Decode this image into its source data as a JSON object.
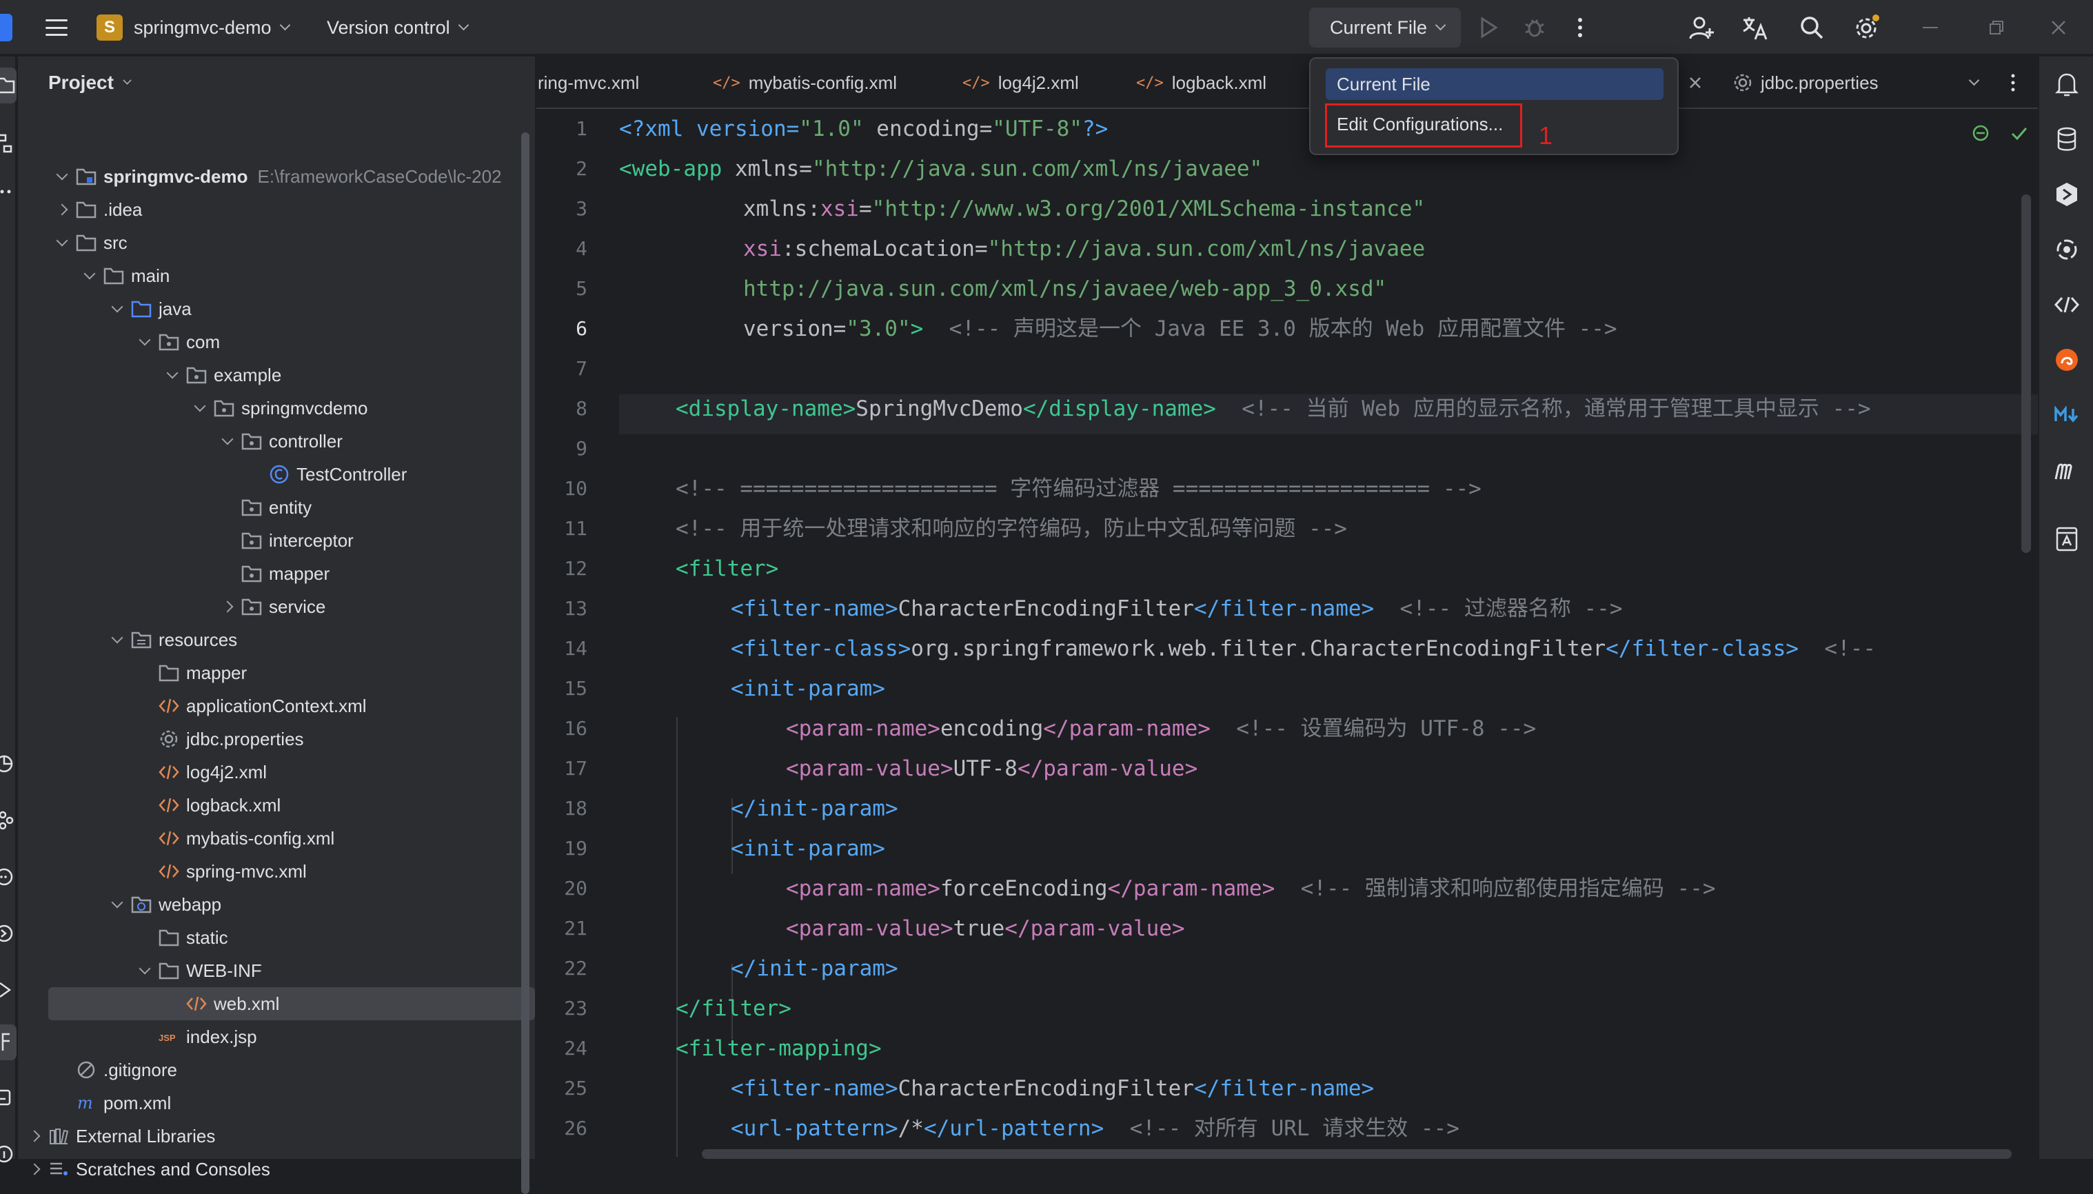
{
  "top_bar": {
    "project_badge": "S",
    "project_name": "springmvc-demo",
    "version_control": "Version control",
    "run_config": "Current File"
  },
  "run_menu": {
    "items": [
      "Current File",
      "Edit Configurations..."
    ],
    "annotation": "1"
  },
  "project_panel": {
    "title": "Project",
    "root_name": "springmvc-demo",
    "root_path": "E:\\frameworkCaseCode\\lc-202",
    "items": [
      ".idea",
      "src",
      "main",
      "java",
      "com",
      "example",
      "springmvcdemo",
      "controller",
      "TestController",
      "entity",
      "interceptor",
      "mapper",
      "service",
      "resources",
      "mapper",
      "applicationContext.xml",
      "jdbc.properties",
      "log4j2.xml",
      "logback.xml",
      "mybatis-config.xml",
      "spring-mvc.xml",
      "webapp",
      "static",
      "WEB-INF",
      "web.xml",
      "index.jsp",
      ".gitignore",
      "pom.xml",
      "External Libraries",
      "Scratches and Consoles"
    ]
  },
  "editor_tabs": [
    "ring-mvc.xml",
    "mybatis-config.xml",
    "log4j2.xml",
    "logback.xml",
    "jdbc.properties"
  ],
  "editor": {
    "current_line": 6,
    "line_numbers": [
      "1",
      "2",
      "3",
      "4",
      "5",
      "6",
      "7",
      "8",
      "9",
      "10",
      "11",
      "12",
      "13",
      "14",
      "15",
      "16",
      "17",
      "18",
      "19",
      "20",
      "21",
      "22",
      "23",
      "24",
      "25",
      "26"
    ],
    "code": {
      "l1": [
        "<?xml version=",
        "\"1.0\"",
        " encoding=",
        "\"UTF-8\"",
        "?>"
      ],
      "l2": [
        "<web-app",
        " xmlns=",
        "\"http://java.sun.com/xml/ns/javaee\""
      ],
      "l3": [
        "xmlns:",
        "xsi",
        "=",
        "\"http://www.w3.org/2001/XMLSchema-instance\""
      ],
      "l4": [
        "xsi",
        ":schemaLocation=",
        "\"http://java.sun.com/xml/ns/javaee"
      ],
      "l5": [
        "http://java.sun.com/xml/ns/javaee/web-app_3_0.xsd\""
      ],
      "l6": [
        "version=",
        "\"3.0\"",
        ">",
        "  <!-- 声明这是一个 Java EE 3.0 版本的 Web 应用配置文件 -->"
      ],
      "l8": [
        "<display-name>",
        "SpringMvcDemo",
        "</display-name>",
        "  <!-- 当前 Web 应用的显示名称，通常用于管理工具中显示 -->"
      ],
      "l10": [
        "<!-- ==================== 字符编码过滤器 ==================== -->"
      ],
      "l11": [
        "<!-- 用于统一处理请求和响应的字符编码，防止中文乱码等问题 -->"
      ],
      "l12": [
        "<filter>"
      ],
      "l13": [
        "<filter-name>",
        "CharacterEncodingFilter",
        "</filter-name>",
        "  <!-- 过滤器名称 -->"
      ],
      "l14": [
        "<filter-class>",
        "org.springframework.web.filter.CharacterEncodingFilter",
        "</filter-class>",
        "  <!--"
      ],
      "l15": [
        "<init-param>"
      ],
      "l16": [
        "<param-name>",
        "encoding",
        "</param-name>",
        "  <!-- 设置编码为 UTF-8 -->"
      ],
      "l17": [
        "<param-value>",
        "UTF-8",
        "</param-value>"
      ],
      "l18": [
        "</init-param>"
      ],
      "l19": [
        "<init-param>"
      ],
      "l20": [
        "<param-name>",
        "forceEncoding",
        "</param-name>",
        "  <!-- 强制请求和响应都使用指定编码 -->"
      ],
      "l21": [
        "<param-value>",
        "true",
        "</param-value>"
      ],
      "l22": [
        "</init-param>"
      ],
      "l23": [
        "</filter>"
      ],
      "l24": [
        "<filter-mapping>"
      ],
      "l25": [
        "<filter-name>",
        "CharacterEncodingFilter",
        "</filter-name>"
      ],
      "l26": [
        "<url-pattern>",
        "/*",
        "</url-pattern>",
        "  <!-- 对所有 URL 请求生效 -->"
      ]
    }
  },
  "colors": {
    "accent": "#3574f0",
    "popup_selected": "#2e436e",
    "annotation": "#e02020",
    "xml_tag": "#56a8f5",
    "xml_string": "#6aab73",
    "comment": "#7a7e85"
  }
}
